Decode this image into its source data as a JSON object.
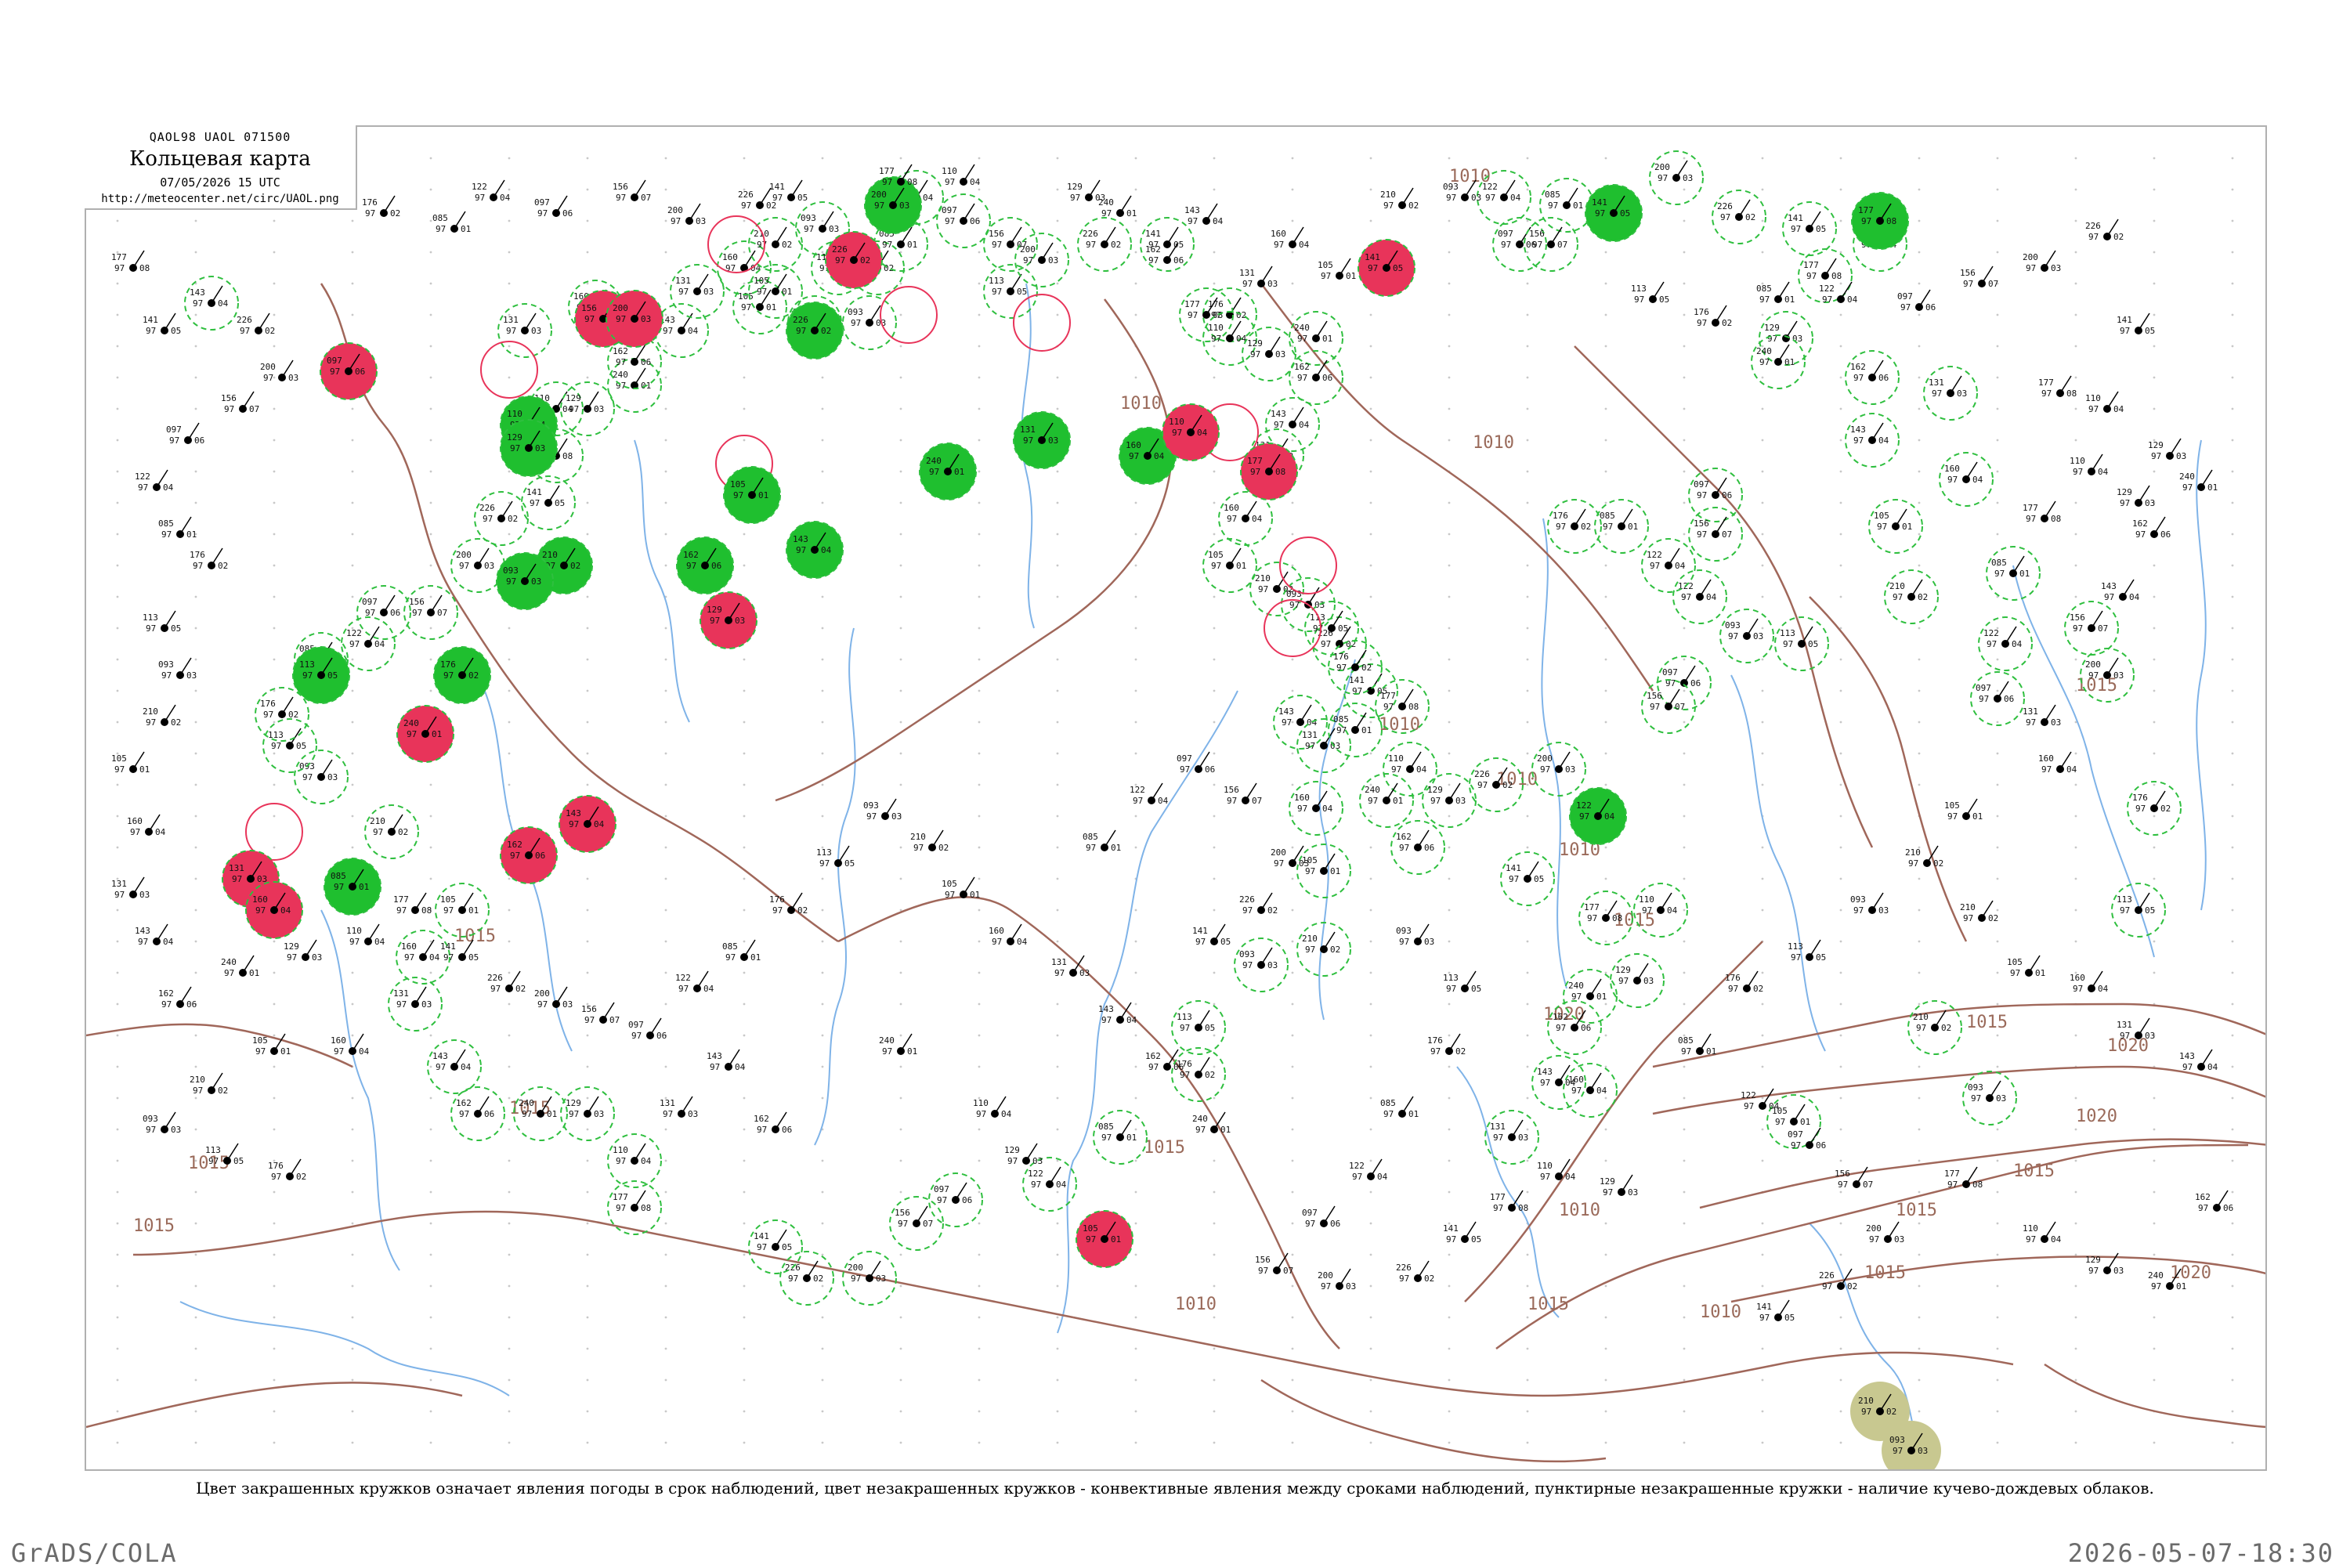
{
  "header": {
    "code": "QAOL98  UAOL  071500",
    "title": "Кольцевая карта",
    "time": "07/05/2026 15 UTC",
    "url": "http://meteocenter.net/circ/UAOL.png"
  },
  "caption": "Цвет закрашенных кружков означает явления погоды в срок наблюдений, цвет незакрашенных кружков - конвективные явления между сроками наблюдений, пунктирные незакрашенные кружки - наличие кучево-дождевых облаков.",
  "footer": {
    "left": "GrADS/COLA",
    "right": "2026-05-07-18:30"
  },
  "colors": {
    "isobar": "#a0675a",
    "river": "#7fb3e8",
    "thunder_fill": "#e8345a",
    "rain_fill": "#1fbf2f",
    "haze_fill": "#c8c890",
    "cb_dashed": "#2fbf3f",
    "conv_ring": "#e8345a"
  },
  "isobar_labels": [
    {
      "text": "1010",
      "key": "a"
    },
    {
      "text": "1010",
      "key": "b"
    },
    {
      "text": "1010",
      "key": "c"
    },
    {
      "text": "1010",
      "key": "d"
    },
    {
      "text": "1015",
      "key": "e"
    },
    {
      "text": "1015",
      "key": "f"
    },
    {
      "text": "1015",
      "key": "g"
    },
    {
      "text": "1015",
      "key": "h"
    },
    {
      "text": "1010",
      "key": "i"
    },
    {
      "text": "1010",
      "key": "j"
    },
    {
      "text": "1015",
      "key": "k"
    },
    {
      "text": "1020",
      "key": "l"
    },
    {
      "text": "1015",
      "key": "m"
    },
    {
      "text": "1015",
      "key": "n"
    },
    {
      "text": "1020",
      "key": "o"
    },
    {
      "text": "1015",
      "key": "p"
    },
    {
      "text": "1020",
      "key": "q"
    },
    {
      "text": "1010",
      "key": "r"
    },
    {
      "text": "1015",
      "key": "s"
    },
    {
      "text": "1015",
      "key": "t"
    },
    {
      "text": "1010",
      "key": "u"
    },
    {
      "text": "1020",
      "key": "v"
    },
    {
      "text": "1015",
      "key": "w"
    },
    {
      "text": "1010",
      "key": "x"
    },
    {
      "text": "1015",
      "key": "y"
    }
  ],
  "station_samples": [
    {
      "pressure": "143",
      "temp": "97",
      "dew": "04"
    },
    {
      "pressure": "131",
      "temp": "97",
      "dew": "03"
    },
    {
      "pressure": "160",
      "temp": "97",
      "dew": "04"
    },
    {
      "pressure": "105",
      "temp": "97",
      "dew": "01"
    },
    {
      "pressure": "210",
      "temp": "97",
      "dew": "02"
    },
    {
      "pressure": "093",
      "temp": "97",
      "dew": "03"
    },
    {
      "pressure": "113",
      "temp": "97",
      "dew": "05"
    },
    {
      "pressure": "176",
      "temp": "97",
      "dew": "02"
    },
    {
      "pressure": "085",
      "temp": "97",
      "dew": "01"
    },
    {
      "pressure": "122",
      "temp": "97",
      "dew": "04"
    },
    {
      "pressure": "097",
      "temp": "97",
      "dew": "06"
    },
    {
      "pressure": "156",
      "temp": "97",
      "dew": "07"
    },
    {
      "pressure": "200",
      "temp": "97",
      "dew": "03"
    },
    {
      "pressure": "226",
      "temp": "97",
      "dew": "02"
    },
    {
      "pressure": "141",
      "temp": "97",
      "dew": "05"
    },
    {
      "pressure": "177",
      "temp": "97",
      "dew": "08"
    },
    {
      "pressure": "110",
      "temp": "97",
      "dew": "04"
    },
    {
      "pressure": "129",
      "temp": "97",
      "dew": "03"
    },
    {
      "pressure": "240",
      "temp": "97",
      "dew": "01"
    },
    {
      "pressure": "162",
      "temp": "97",
      "dew": "06"
    }
  ]
}
